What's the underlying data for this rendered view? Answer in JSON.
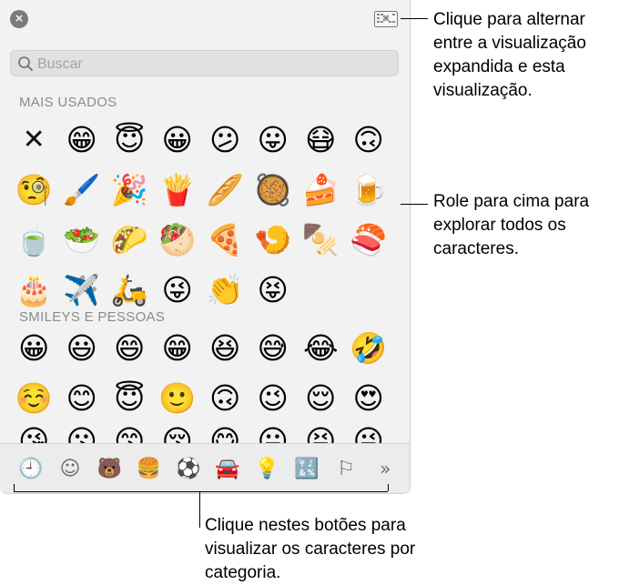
{
  "panel": {
    "close_icon": "close-icon",
    "toggle_icon": "expanded-view-icon",
    "search_placeholder": "Buscar"
  },
  "sections": [
    {
      "title": "MAIS USADOS",
      "items": [
        "✕",
        "😁",
        "😇",
        "😀",
        "😕",
        "😛",
        "😷",
        "🙃",
        "🧐",
        "🖌️",
        "🎉",
        "🍟",
        "🥖",
        "🥘",
        "🍰",
        "🍺",
        "🍵",
        "🥗",
        "🌮",
        "🥙",
        "🍕",
        "🍤",
        "🍢",
        "🍣",
        "🎂",
        "✈️",
        "🛵",
        "😜",
        "👏",
        "😝"
      ]
    },
    {
      "title": "SMILEYS E PESSOAS",
      "items": [
        "😀",
        "😃",
        "😄",
        "😁",
        "😆",
        "😅",
        "😂",
        "🤣",
        "☺️",
        "😊",
        "😇",
        "🙂",
        "🙃",
        "😉",
        "😌",
        "😍"
      ],
      "partial_row": [
        "😘",
        "😗",
        "😙",
        "😚",
        "😋",
        "😛",
        "😝",
        "😜"
      ]
    }
  ],
  "tabs": [
    {
      "name": "tab-recent",
      "glyph": "🕘",
      "icon": "clock-icon"
    },
    {
      "name": "tab-smileys",
      "glyph": "☺",
      "icon": "smiley-icon"
    },
    {
      "name": "tab-animals",
      "glyph": "🐻",
      "icon": "bear-icon"
    },
    {
      "name": "tab-food",
      "glyph": "🍔",
      "icon": "food-icon"
    },
    {
      "name": "tab-activities",
      "glyph": "⚽",
      "icon": "soccer-ball-icon"
    },
    {
      "name": "tab-travel",
      "glyph": "🚘",
      "icon": "car-icon"
    },
    {
      "name": "tab-objects",
      "glyph": "💡",
      "icon": "lightbulb-icon"
    },
    {
      "name": "tab-symbols",
      "glyph": "🔣",
      "icon": "symbols-icon"
    },
    {
      "name": "tab-flags",
      "glyph": "⚐",
      "icon": "flag-icon"
    },
    {
      "name": "tab-more",
      "glyph": "»",
      "icon": "chevron-double-right-icon"
    }
  ],
  "callouts": {
    "toggle": "Clique para alternar entre a visualização expandida e esta visualização.",
    "scroll": "Role para cima para explorar todos os caracteres.",
    "categories": "Clique nestes botões para visualizar os caracteres por categoria."
  },
  "colors": {
    "accent": "#1a73e8",
    "panel_bg": "#f2f2f2",
    "section_title": "#8b8b8b"
  }
}
